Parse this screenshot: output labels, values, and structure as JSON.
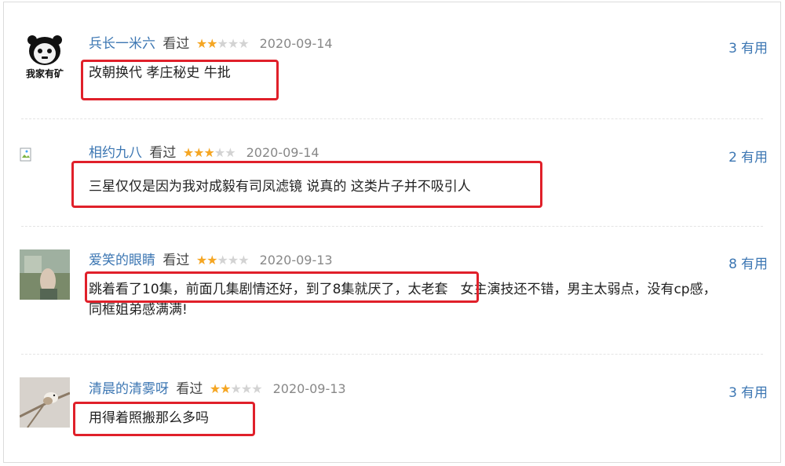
{
  "comments": [
    {
      "user": "兵长一米六",
      "watched": "看过",
      "stars": "★★",
      "stars_off": "★★★",
      "rating": 2,
      "date": "2020-09-14",
      "votes": "3",
      "votes_label": "有用",
      "text": "改朝换代 孝庄秘史 牛批",
      "avatar_text": "我家有矿"
    },
    {
      "user": "相约九八",
      "watched": "看过",
      "stars": "★★★",
      "stars_off": "★★",
      "rating": 3,
      "date": "2020-09-14",
      "votes": "2",
      "votes_label": "有用",
      "text": "三星仅仅是因为我对成毅有司凤滤镜 说真的 这类片子并不吸引人"
    },
    {
      "user": "爱笑的眼睛",
      "watched": "看过",
      "stars": "★★",
      "stars_off": "★★★",
      "rating": 2,
      "date": "2020-09-13",
      "votes": "8",
      "votes_label": "有用",
      "text_line1_a": "跳着看了10集，前面几集剧情还好，到了8集就厌了，太老套",
      "text_line1_b": "女主演技还不错，男主太弱点，没有cp感，",
      "text_line2": "同框姐弟感满满!"
    },
    {
      "user": "清晨的清雾呀",
      "watched": "看过",
      "stars": "★★",
      "stars_off": "★★★",
      "rating": 2,
      "date": "2020-09-13",
      "votes": "3",
      "votes_label": "有用",
      "text": "用得着照搬那么多吗"
    }
  ],
  "colors": {
    "link": "#3d77b3",
    "star": "#f5a623",
    "highlight": "#e0202a"
  }
}
